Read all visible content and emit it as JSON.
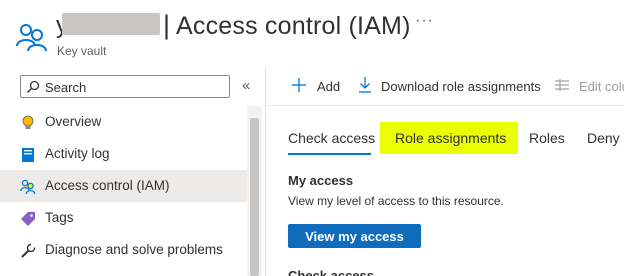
{
  "header": {
    "name_prefix": "y",
    "title_separator": "|",
    "title": "Access control (IAM)",
    "subtitle": "Key vault",
    "more_label": "···",
    "icon": "people-icon"
  },
  "sidebar": {
    "search_placeholder": "Search",
    "collapse_label": "«",
    "items": [
      {
        "label": "Overview",
        "icon": "lightbulb-icon"
      },
      {
        "label": "Activity log",
        "icon": "activity-log-icon"
      },
      {
        "label": "Access control (IAM)",
        "icon": "people-icon",
        "active": true
      },
      {
        "label": "Tags",
        "icon": "tag-icon"
      },
      {
        "label": "Diagnose and solve problems",
        "icon": "wrench-icon"
      }
    ]
  },
  "toolbar": {
    "add_label": "Add",
    "download_label": "Download role assignments",
    "edit_columns_label": "Edit colu"
  },
  "tabs": [
    {
      "label": "Check access",
      "selected": true
    },
    {
      "label": "Role assignments",
      "highlighted": true
    },
    {
      "label": "Roles"
    },
    {
      "label": "Deny a"
    }
  ],
  "content": {
    "my_access_heading": "My access",
    "my_access_description": "View my level of access to this resource.",
    "view_access_button": "View my access",
    "check_access_heading": "Check access"
  },
  "colors": {
    "accent": "#0078d4",
    "button": "#0f6cbd",
    "highlight": "#eaff00"
  }
}
